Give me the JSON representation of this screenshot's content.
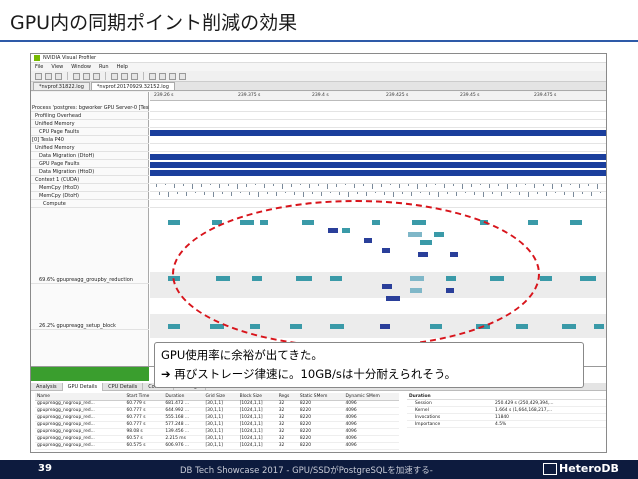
{
  "slide": {
    "title": "GPU内の同期ポイント削減の効果",
    "page_number": "39",
    "footer_text": "DB Tech Showcase 2017 - GPU/SSDがPostgreSQLを加速する-",
    "logo_text": "HeteroDB"
  },
  "app": {
    "window_title": "NVIDIA Visual Profiler",
    "menu": [
      "File",
      "View",
      "Window",
      "Run",
      "Help"
    ],
    "tabs": [
      "*nvprof.31822.log",
      "*nvprof.20170929.32152.log"
    ]
  },
  "timeline": {
    "ruler": [
      "239.26 s",
      "239.375 s",
      "239.4 s",
      "239.425 s",
      "239.45 s",
      "239.475 s"
    ],
    "tree": [
      "Process 'postgres: bgworker GPU Server-0 [Tesla P40]...",
      "Profiling Overhead",
      "Unified Memory",
      "CPU Page Faults",
      "[0] Tesla P40",
      "Unified Memory",
      "Data Migration (DtoH)",
      "GPU Page Faults",
      "Data Migration (HtoD)",
      "Context 1 (CUDA)",
      "MemCpy (HtoD)",
      "MemCpy (DtoH)",
      "Compute",
      "69.6% gpupreagg_groupby_reduction",
      "26.2% gpupreagg_setup_block"
    ]
  },
  "callout": {
    "line1": "GPU使用率に余裕が出てきた。",
    "line2": "➔ 再びストレージ律速に。10GB/sは十分耐えられそう。"
  },
  "bottom": {
    "tabs": [
      "Analysis",
      "GPU Details",
      "CPU Details",
      "Console",
      "Settings"
    ],
    "table_headers": [
      "Name",
      "Start Time",
      "Duration",
      "Grid Size",
      "Block Size",
      "Regs",
      "Static SMem",
      "Dynamic SMem"
    ],
    "table_rows": [
      [
        "gpupreagg_nogroup_red...",
        "60.779 s",
        "681.472 ...",
        "[30,1,1]",
        "[1024,1,1]",
        "32",
        "8220",
        "4096"
      ],
      [
        "gpupreagg_nogroup_red...",
        "60.777 s",
        "644.992 ...",
        "[30,1,1]",
        "[1024,1,1]",
        "32",
        "8220",
        "4096"
      ],
      [
        "gpupreagg_nogroup_red...",
        "60.777 s",
        "555.168 ...",
        "[30,1,1]",
        "[1024,1,1]",
        "32",
        "8220",
        "4096"
      ],
      [
        "gpupreagg_nogroup_red...",
        "60.777 s",
        "577.248 ...",
        "[30,1,1]",
        "[1024,1,1]",
        "32",
        "8220",
        "4096"
      ],
      [
        "gpupreagg_nogroup_red...",
        "98.08 s",
        "139.456 ...",
        "[30,1,1]",
        "[1024,1,1]",
        "32",
        "8220",
        "4096"
      ],
      [
        "gpupreagg_nogroup_red...",
        "60.57 s",
        "2.215 ms",
        "[30,1,1]",
        "[1024,1,1]",
        "32",
        "8220",
        "4096"
      ],
      [
        "gpupreagg_nogroup_red...",
        "60.575 s",
        "606.976 ...",
        "[30,1,1]",
        "[1024,1,1]",
        "32",
        "8220",
        "4096"
      ]
    ],
    "props_title": "Duration",
    "props": [
      [
        "Session",
        "250.429 s (250,429,394,..."
      ],
      [
        "Kernel",
        "1.664 s (1,664,168,217,..."
      ],
      [
        "Invocations",
        "11840"
      ],
      [
        "Importance",
        "4.5%"
      ]
    ]
  },
  "colors": {
    "accent": "#2e5aa8",
    "footer_bg": "#0d1b3e",
    "kernel": "#3a9aa8",
    "kernel_dark": "#2a3f9a",
    "uvm_bar": "#1a3e9c",
    "ellipse": "#d8141b",
    "status_green": "#3a9e2e"
  }
}
